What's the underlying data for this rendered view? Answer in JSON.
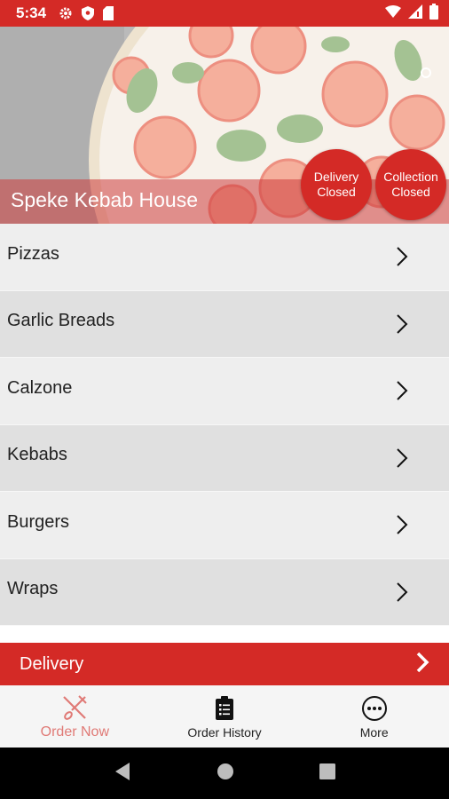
{
  "status_bar": {
    "time": "5:34",
    "left_icons": [
      "gear-icon",
      "shield-icon",
      "sd-card-icon"
    ],
    "right_icons": [
      "wifi-icon",
      "signal-icon",
      "battery-icon"
    ]
  },
  "hero": {
    "restaurant_name": "Speke Kebab House",
    "delivery_badge": {
      "line1": "Delivery",
      "line2": "Closed"
    },
    "collection_badge": {
      "line1": "Collection",
      "line2": "Closed"
    }
  },
  "categories": [
    {
      "label": "Pizzas"
    },
    {
      "label": "Garlic Breads"
    },
    {
      "label": "Calzone"
    },
    {
      "label": "Kebabs"
    },
    {
      "label": "Burgers"
    },
    {
      "label": "Wraps"
    }
  ],
  "delivery_bar": {
    "label": "Delivery"
  },
  "bottom_nav": {
    "order_now": "Order Now",
    "order_history": "Order History",
    "more": "More"
  },
  "colors": {
    "accent": "#d42a26",
    "active_tab": "#e07a76"
  }
}
